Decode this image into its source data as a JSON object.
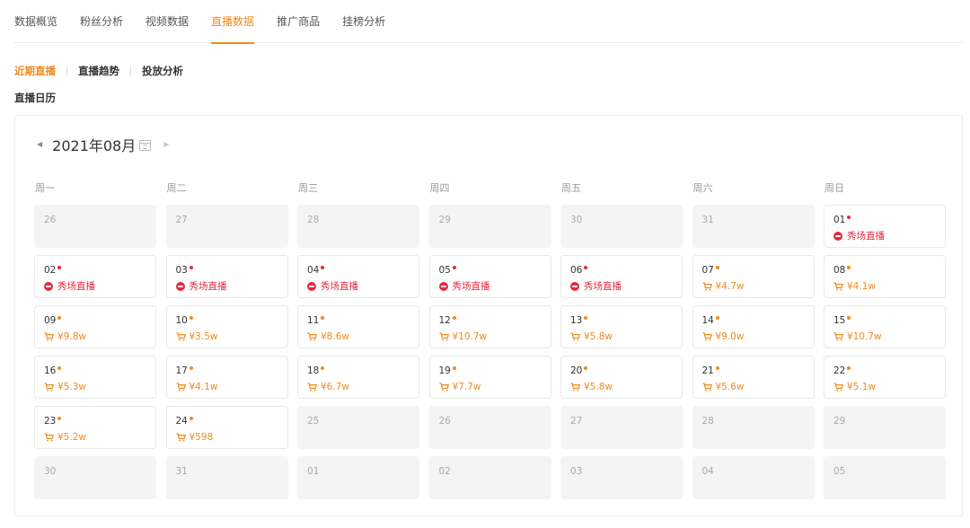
{
  "top_tabs": [
    {
      "label": "数据概览",
      "active": false
    },
    {
      "label": "粉丝分析",
      "active": false
    },
    {
      "label": "视频数据",
      "active": false
    },
    {
      "label": "直播数据",
      "active": true
    },
    {
      "label": "推广商品",
      "active": false
    },
    {
      "label": "挂榜分析",
      "active": false
    }
  ],
  "sub_tabs": [
    {
      "label": "近期直播",
      "active": true
    },
    {
      "label": "直播趋势",
      "active": false
    },
    {
      "label": "投放分析",
      "active": false
    }
  ],
  "section_title": "直播日历",
  "calendar": {
    "month_label": "2021年08月",
    "prev_icon": "caret-left-icon",
    "next_icon": "caret-right-icon",
    "calendar_icon": "calendar-icon",
    "weekdays": [
      "周一",
      "周二",
      "周三",
      "周四",
      "周五",
      "周六",
      "周日"
    ],
    "colors": {
      "accent": "#f28a1e",
      "live": "#e5293d",
      "out_bg": "#f4f4f4"
    },
    "days": [
      {
        "day": "26",
        "in_month": false
      },
      {
        "day": "27",
        "in_month": false
      },
      {
        "day": "28",
        "in_month": false
      },
      {
        "day": "29",
        "in_month": false
      },
      {
        "day": "30",
        "in_month": false
      },
      {
        "day": "31",
        "in_month": false
      },
      {
        "day": "01",
        "in_month": true,
        "type": "live",
        "text": "秀场直播"
      },
      {
        "day": "02",
        "in_month": true,
        "type": "live",
        "text": "秀场直播"
      },
      {
        "day": "03",
        "in_month": true,
        "type": "live",
        "text": "秀场直播"
      },
      {
        "day": "04",
        "in_month": true,
        "type": "live",
        "text": "秀场直播"
      },
      {
        "day": "05",
        "in_month": true,
        "type": "live",
        "text": "秀场直播"
      },
      {
        "day": "06",
        "in_month": true,
        "type": "live",
        "text": "秀场直播"
      },
      {
        "day": "07",
        "in_month": true,
        "type": "sales",
        "text": "¥4.7w"
      },
      {
        "day": "08",
        "in_month": true,
        "type": "sales",
        "text": "¥4.1w"
      },
      {
        "day": "09",
        "in_month": true,
        "type": "sales",
        "text": "¥9.8w"
      },
      {
        "day": "10",
        "in_month": true,
        "type": "sales",
        "text": "¥3.5w"
      },
      {
        "day": "11",
        "in_month": true,
        "type": "sales",
        "text": "¥8.6w"
      },
      {
        "day": "12",
        "in_month": true,
        "type": "sales",
        "text": "¥10.7w"
      },
      {
        "day": "13",
        "in_month": true,
        "type": "sales",
        "text": "¥5.8w"
      },
      {
        "day": "14",
        "in_month": true,
        "type": "sales",
        "text": "¥9.0w"
      },
      {
        "day": "15",
        "in_month": true,
        "type": "sales",
        "text": "¥10.7w"
      },
      {
        "day": "16",
        "in_month": true,
        "type": "sales",
        "text": "¥5.3w"
      },
      {
        "day": "17",
        "in_month": true,
        "type": "sales",
        "text": "¥4.1w"
      },
      {
        "day": "18",
        "in_month": true,
        "type": "sales",
        "text": "¥6.7w"
      },
      {
        "day": "19",
        "in_month": true,
        "type": "sales",
        "text": "¥7.7w"
      },
      {
        "day": "20",
        "in_month": true,
        "type": "sales",
        "text": "¥5.8w"
      },
      {
        "day": "21",
        "in_month": true,
        "type": "sales",
        "text": "¥5.6w"
      },
      {
        "day": "22",
        "in_month": true,
        "type": "sales",
        "text": "¥5.1w"
      },
      {
        "day": "23",
        "in_month": true,
        "type": "sales",
        "text": "¥5.2w"
      },
      {
        "day": "24",
        "in_month": true,
        "type": "sales",
        "text": "¥598"
      },
      {
        "day": "25",
        "in_month": false
      },
      {
        "day": "26",
        "in_month": false
      },
      {
        "day": "27",
        "in_month": false
      },
      {
        "day": "28",
        "in_month": false
      },
      {
        "day": "29",
        "in_month": false
      },
      {
        "day": "30",
        "in_month": false
      },
      {
        "day": "31",
        "in_month": false
      },
      {
        "day": "01",
        "in_month": false
      },
      {
        "day": "02",
        "in_month": false
      },
      {
        "day": "03",
        "in_month": false
      },
      {
        "day": "04",
        "in_month": false
      },
      {
        "day": "05",
        "in_month": false
      }
    ]
  }
}
